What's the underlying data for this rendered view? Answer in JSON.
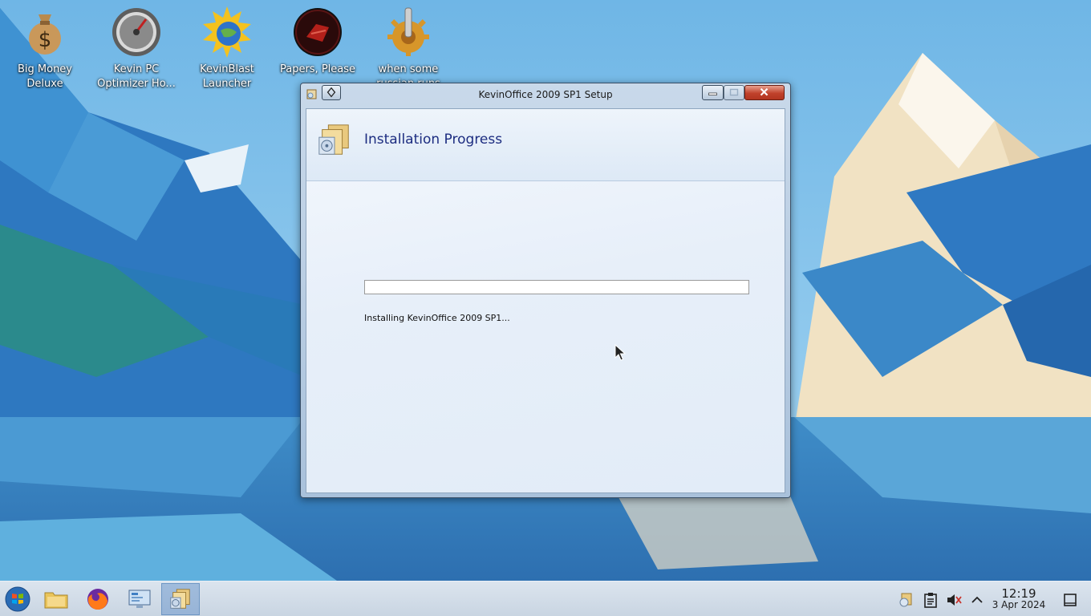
{
  "desktop": {
    "icons": [
      {
        "label": "Big Money Deluxe",
        "icon": "money-bag-icon"
      },
      {
        "label": "Kevin PC Optimizer Ho...",
        "icon": "speedometer-icon"
      },
      {
        "label": "KevinBlast Launcher",
        "icon": "globe-sun-icon"
      },
      {
        "label": "Papers, Please",
        "icon": "papers-please-icon"
      },
      {
        "label": "when some russian runs a...",
        "icon": "gear-icon"
      }
    ]
  },
  "window": {
    "title": "KevinOffice 2009 SP1 Setup",
    "page_title": "Installation Progress",
    "status_text": "Installing KevinOffice 2009 SP1...",
    "progress": 0
  },
  "taskbar": {
    "apps": [
      {
        "name": "start-button",
        "icon": "windows-orb-icon"
      },
      {
        "name": "file-manager",
        "icon": "folder-icon"
      },
      {
        "name": "firefox",
        "icon": "firefox-icon"
      },
      {
        "name": "control-panel",
        "icon": "control-panel-icon"
      },
      {
        "name": "setup-task",
        "icon": "installer-icon",
        "active": true
      }
    ],
    "tray_icons": [
      "installer-tray-icon",
      "clipboard-icon",
      "volume-muted-icon",
      "chevron-up-icon"
    ],
    "clock_time": "12:19",
    "clock_date": "3 Apr 2024"
  },
  "colors": {
    "title_blue": "#1c2c80",
    "close_red": "#c0412b",
    "taskbar": "#d3dde8"
  }
}
